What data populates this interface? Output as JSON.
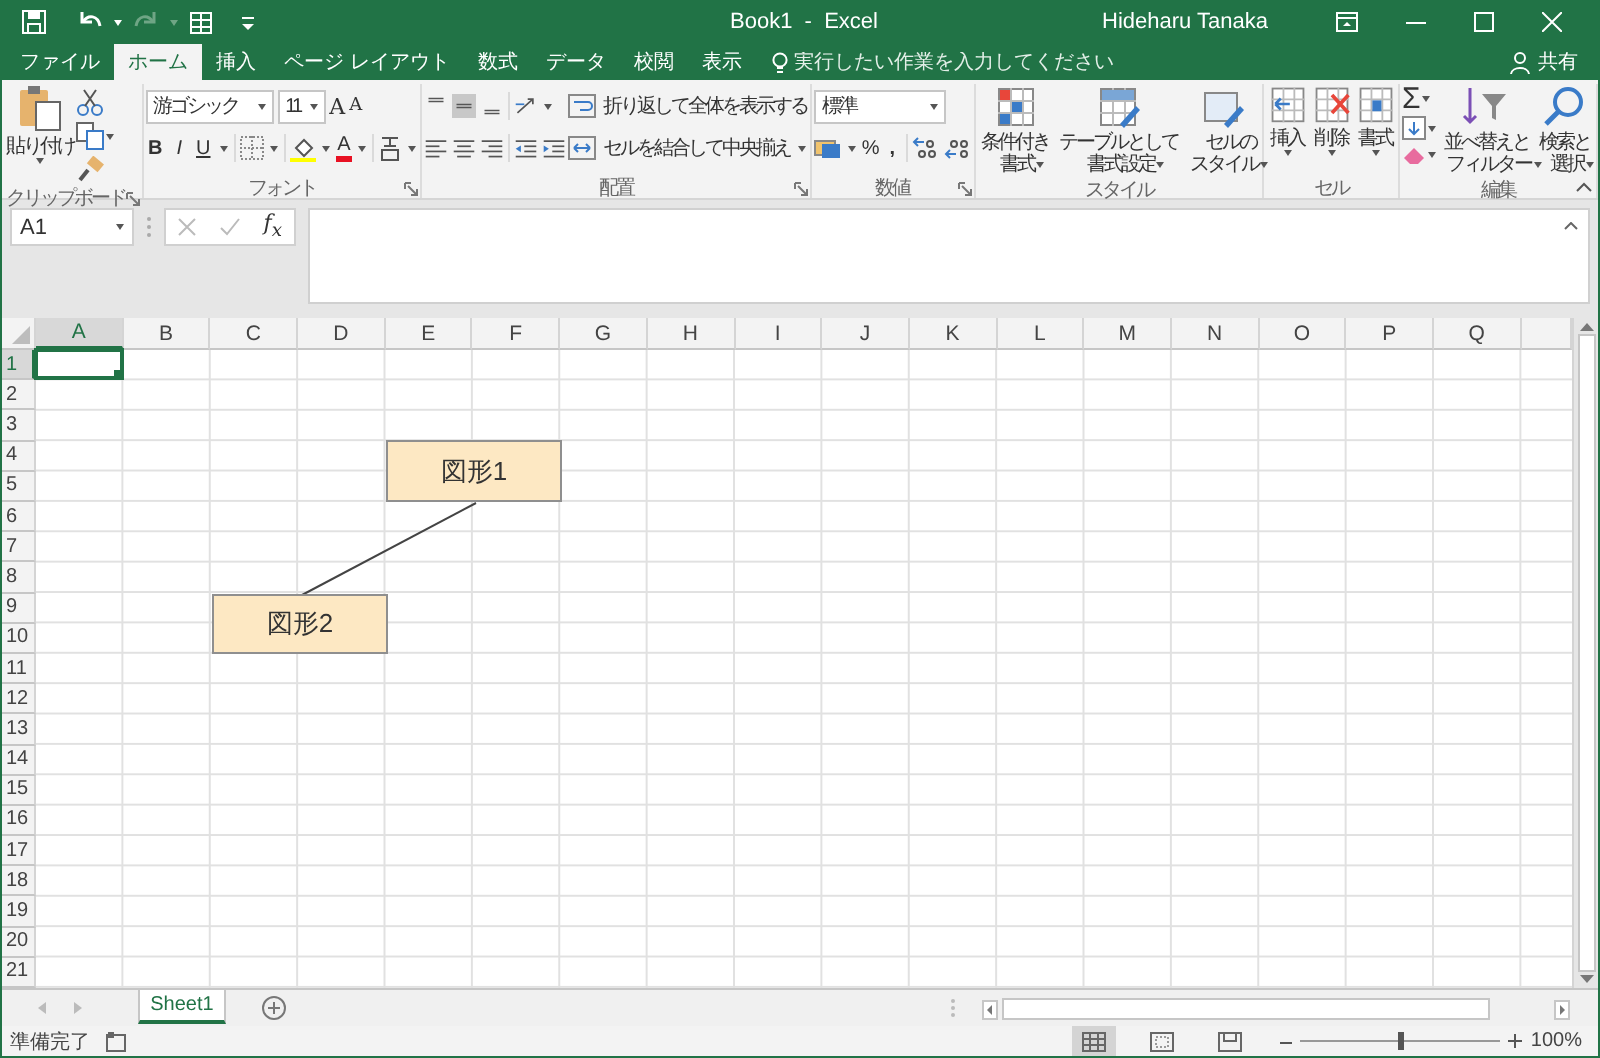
{
  "title_bar": {
    "title": "Book1  -  Excel",
    "user": "Hideharu Tanaka",
    "redo": {
      "disabled": true
    }
  },
  "tabs": [
    {
      "label": "ファイル",
      "selected": false
    },
    {
      "label": "ホーム",
      "selected": true
    },
    {
      "label": "挿入",
      "selected": false
    },
    {
      "label": "ページ レイアウト",
      "selected": false
    },
    {
      "label": "数式",
      "selected": false
    },
    {
      "label": "データ",
      "selected": false
    },
    {
      "label": "校閲",
      "selected": false
    },
    {
      "label": "表示",
      "selected": false
    }
  ],
  "tell_me": {
    "placeholder": "実行したい作業を入力してください"
  },
  "share": "共有",
  "ribbon": {
    "clipboard": {
      "label": "クリップボード",
      "paste": "貼り付け"
    },
    "font": {
      "label": "フォント",
      "font_name": "游ゴシック",
      "font_size": "11",
      "grow": "A",
      "shrink": "A",
      "bold": "B",
      "italic": "I",
      "underline": "U",
      "font_color": "A"
    },
    "alignment": {
      "label": "配置",
      "vertical_align": [
        {
          "selected": false
        },
        {
          "selected": true
        },
        {
          "selected": false
        }
      ],
      "wrap_text": "折り返して全体を表示する",
      "merge_center": "セルを結合して中央揃え"
    },
    "number": {
      "label": "数値",
      "format": "標準",
      "percent": "%",
      "comma": ","
    },
    "styles": {
      "label": "スタイル",
      "buttons": [
        "条件付き書式",
        "テーブルとして書式設定",
        "セルのスタイル"
      ]
    },
    "cells": {
      "label": "セル",
      "buttons": [
        "挿入",
        "削除",
        "書式"
      ]
    },
    "editing": {
      "label": "編集",
      "autosum": "Σ",
      "buttons": [
        "並べ替えとフィルター",
        "検索と選択"
      ]
    }
  },
  "name_box": "A1",
  "formula_bar": {
    "insert_function": "f$_{x}$"
  },
  "grid": {
    "columns": [
      {
        "label": "A",
        "selected": true
      },
      {
        "label": "B",
        "selected": false
      },
      {
        "label": "C",
        "selected": false
      },
      {
        "label": "D",
        "selected": false
      },
      {
        "label": "E",
        "selected": false
      },
      {
        "label": "F",
        "selected": false
      },
      {
        "label": "G",
        "selected": false
      },
      {
        "label": "H",
        "selected": false
      },
      {
        "label": "I",
        "selected": false
      },
      {
        "label": "J",
        "selected": false
      },
      {
        "label": "K",
        "selected": false
      },
      {
        "label": "L",
        "selected": false
      },
      {
        "label": "M",
        "selected": false
      },
      {
        "label": "N",
        "selected": false
      },
      {
        "label": "O",
        "selected": false
      },
      {
        "label": "P",
        "selected": false
      },
      {
        "label": "Q",
        "selected": false
      }
    ],
    "rows": [
      {
        "label": "1",
        "selected": true
      },
      {
        "label": "2",
        "selected": false
      },
      {
        "label": "3",
        "selected": false
      },
      {
        "label": "4",
        "selected": false
      },
      {
        "label": "5",
        "selected": false
      },
      {
        "label": "6",
        "selected": false
      },
      {
        "label": "7",
        "selected": false
      },
      {
        "label": "8",
        "selected": false
      },
      {
        "label": "9",
        "selected": false
      },
      {
        "label": "10",
        "selected": false
      },
      {
        "label": "11",
        "selected": false
      },
      {
        "label": "12",
        "selected": false
      },
      {
        "label": "13",
        "selected": false
      },
      {
        "label": "14",
        "selected": false
      },
      {
        "label": "15",
        "selected": false
      },
      {
        "label": "16",
        "selected": false
      },
      {
        "label": "17",
        "selected": false
      },
      {
        "label": "18",
        "selected": false
      },
      {
        "label": "19",
        "selected": false
      },
      {
        "label": "20",
        "selected": false
      },
      {
        "label": "21",
        "selected": false
      }
    ]
  },
  "shapes": [
    {
      "text": "図形1"
    },
    {
      "text": "図形2"
    }
  ],
  "sheet_tabs": [
    {
      "label": "Sheet1",
      "selected": true
    }
  ],
  "status_bar": {
    "status": "準備完了",
    "views": [
      {
        "selected": true
      },
      {
        "selected": false
      },
      {
        "selected": false
      }
    ],
    "zoom": {
      "level": 0.5,
      "reading": "100%"
    }
  }
}
